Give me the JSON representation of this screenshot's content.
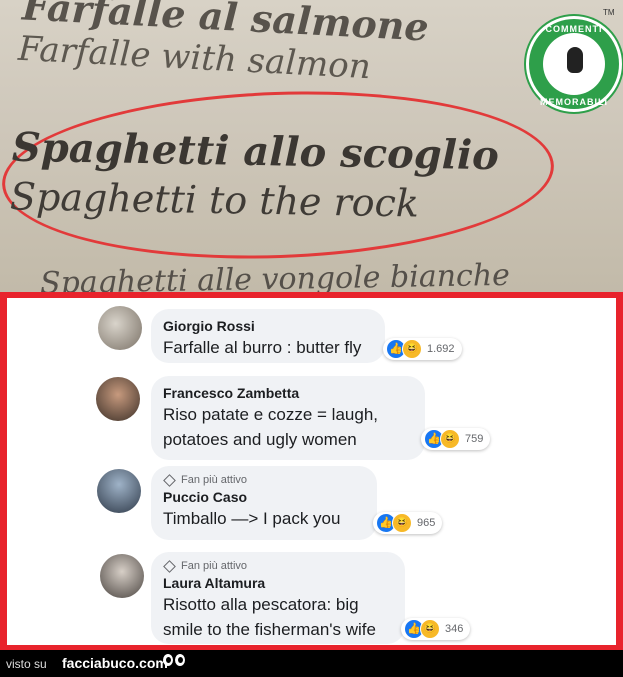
{
  "menu": {
    "line1": "Farfalle al salmone",
    "line2": "Farfalle with salmon",
    "line3": "Spaghetti allo scoglio",
    "line4": "Spaghetti to the rock",
    "line5": "Spaghetti alle vongole bianche"
  },
  "badge": {
    "top_text": "COMMENTI",
    "bottom_text": "MEMORABILI",
    "trademark": "TM"
  },
  "comments": [
    {
      "name": "Giorgio Rossi",
      "fan_label": "",
      "text_lines": [
        "Farfalle al burro : butter fly"
      ],
      "reaction_count": "1.692"
    },
    {
      "name": "Francesco Zambetta",
      "fan_label": "",
      "text_lines": [
        "Riso patate e cozze = laugh,",
        "potatoes and ugly women"
      ],
      "reaction_count": "759"
    },
    {
      "name": "Puccio Caso",
      "fan_label": "Fan più attivo",
      "text_lines": [
        "Timballo —> I pack you"
      ],
      "reaction_count": "965"
    },
    {
      "name": "Laura Altamura",
      "fan_label": "Fan più attivo",
      "text_lines": [
        "Risotto alla pescatora: big",
        "smile to the fisherman's wife"
      ],
      "reaction_count": "346"
    }
  ],
  "footer": {
    "visto_su": "visto su",
    "site": "facciabuco.com"
  },
  "colors": {
    "frame_red": "#e8232c",
    "bubble_bg": "#f0f2f5",
    "like_blue": "#1877f2",
    "haha_yellow": "#f7b928",
    "badge_green": "#2e9f4a"
  }
}
